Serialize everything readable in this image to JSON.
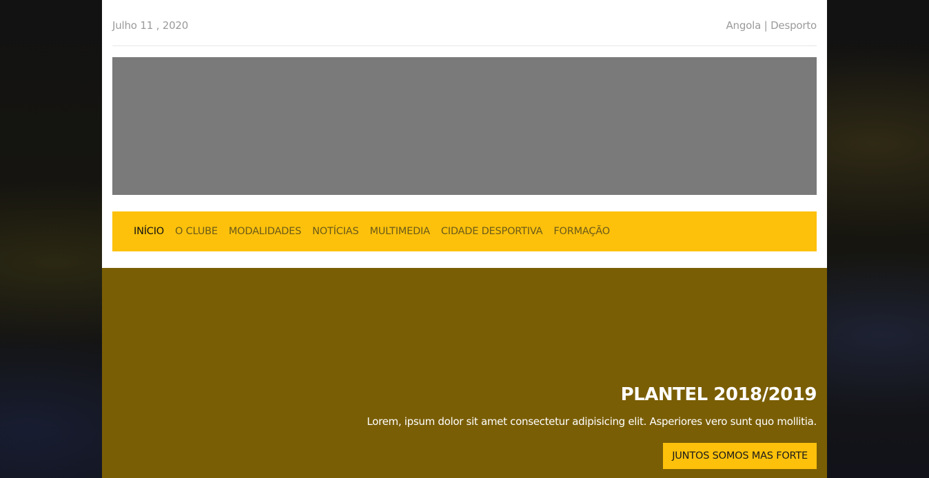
{
  "topbar": {
    "date": "Julho 11 , 2020",
    "location": "Angola | Desporto"
  },
  "nav": {
    "items": [
      {
        "label": "INÍCIO",
        "active": true
      },
      {
        "label": "O CLUBE",
        "active": false
      },
      {
        "label": "MODALIDADES",
        "active": false
      },
      {
        "label": "NOTÍCIAS",
        "active": false
      },
      {
        "label": "MULTIMEDIA",
        "active": false
      },
      {
        "label": "CIDADE DESPORTIVA",
        "active": false
      },
      {
        "label": "FORMAÇÃO",
        "active": false
      }
    ]
  },
  "hero": {
    "title": "PLANTEL 2018/2019",
    "text": "Lorem, ipsum dolor sit amet consectetur adipisicing elit. Asperiores vero sunt quo mollitia.",
    "button_label": "JUNTOS SOMOS MAS FORTE"
  },
  "colors": {
    "accent": "#fdc10b",
    "hero_background": "#7a5e05",
    "banner_placeholder": "#7a7a7a",
    "nav_text": "#6b5a1a",
    "nav_active_text": "#111111"
  }
}
